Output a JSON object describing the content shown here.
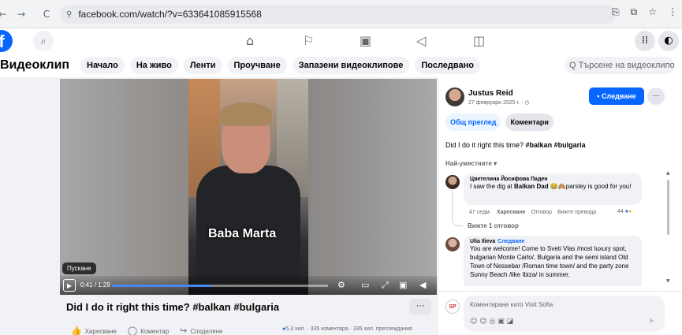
{
  "browser": {
    "url": "facebook.com/watch/?v=633641085915568",
    "back_icon": "←",
    "forward_icon": "→",
    "reload_icon": "C",
    "site_icon": "⚲",
    "translate_icon": "⎘",
    "extension_icon": "⧉",
    "star_icon": "☆",
    "menu_icon": "⋮"
  },
  "header": {
    "logo": "f",
    "search_icon": "⌕",
    "nav": {
      "home": "⌂",
      "flag": "⚐",
      "video": "▣",
      "megaphone": "◁",
      "gaming": "◫"
    },
    "menu_icon": "⁞⁞",
    "messenger_icon": "◐"
  },
  "category": {
    "title": "Видеоклип",
    "pills": [
      "Начало",
      "На живо",
      "Ленти",
      "Проучване",
      "Запазени видеоклипове",
      "Последвано"
    ],
    "search_placeholder": "Q Търсене на видеоклипове"
  },
  "video": {
    "overlay_text": "Baba Marta",
    "tooltip": "Пускане",
    "time": "0:41 / 1:29",
    "progress": 0.46,
    "title": "Did I do it right this time? #balkan #bulgaria",
    "more": "···",
    "controls": {
      "settings": "⚙",
      "captions": "▭",
      "expand": "⤢",
      "pip": "▣",
      "volume": "◀"
    }
  },
  "actions": {
    "like": "Харесване",
    "comment": "Коментар",
    "share": "Споделяне",
    "stats": "5,3 хил. · 335 коментара · 335 хил. преглеждания"
  },
  "post": {
    "author": "Justus Reid",
    "date": "27 февруари 2025 г. · ◷",
    "follow": "Следване",
    "more": "···",
    "tabs": [
      "Общ преглед",
      "Коментари"
    ],
    "text_prefix": "Did I do it right this time? ",
    "text_tags": "#balkan #bulgaria",
    "sort": "Най-уместните ▾"
  },
  "comments": [
    {
      "name": "Цветелина Йосифова Паден",
      "follow": "",
      "text_pre": "I saw the dig at ",
      "text_bold": "Balkan Dad",
      "text_post": " 😂🙈parsley is good for you!",
      "meta_time": "47 седм.",
      "meta_like": "Харесване",
      "meta_reply": "Отговор",
      "meta_translate": "Вижте превода",
      "reactions": "44",
      "view_replies": "Вижте 1 отговор"
    },
    {
      "name": "Ulia Ilieva",
      "follow": "Следване",
      "text": "You are welcome! Come to Sveti Vlas /most luxury spot, bulgarian Monte Carlo/, Bulgaria and the semi island Old Town of Nessebar /Roman time town/ and the party zone Sunny Beach /like Ibiza/ in summer."
    }
  ],
  "composer": {
    "avatar": "SP",
    "placeholder": "Коментиране като Visit Sofia",
    "icons": "☺ ☺ ◎ ▣ ◪",
    "send": "➤"
  },
  "colors": {
    "accent": "#0866ff",
    "bg": "#f0f2f5"
  }
}
